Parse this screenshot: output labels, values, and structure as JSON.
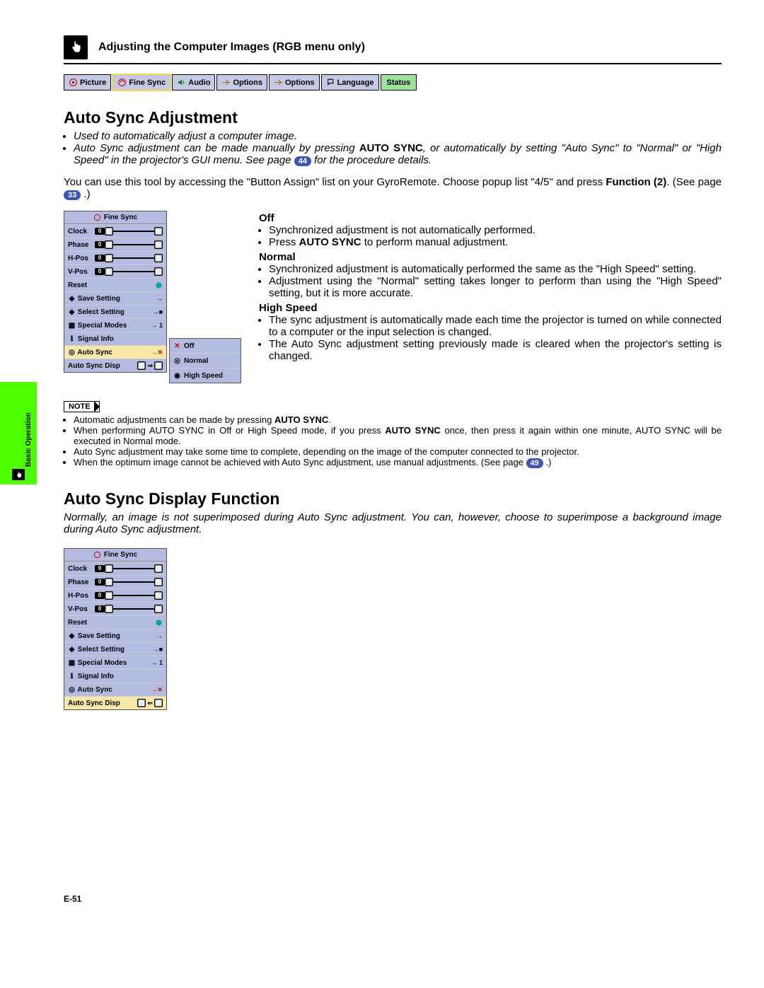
{
  "header": {
    "title": "Adjusting the Computer Images (RGB menu only)"
  },
  "tabs": {
    "picture": "Picture",
    "fine_sync": "Fine Sync",
    "audio": "Audio",
    "options1": "Options",
    "options2": "Options",
    "language": "Language",
    "status": "Status"
  },
  "section1": {
    "title": "Auto Sync Adjustment",
    "intro": {
      "b1": "Used to automatically adjust a computer image.",
      "b2a": "Auto Sync adjustment can be made manually by pressing ",
      "b2b": "AUTO SYNC",
      "b2c": ", or automatically by setting \"Auto Sync\" to \"Normal\" or \"High Speed\" in the projector's GUI menu. See page ",
      "b2_ref": "44",
      "b2d": " for the procedure details."
    },
    "body": {
      "t1": "You can use this tool by accessing the \"Button Assign\" list on your GyroRemote. Choose popup list \"4/5\" and press ",
      "t_bold": "Function (2)",
      "t2": ". (See page ",
      "ref": "33",
      "t3": " .)"
    }
  },
  "osd_menu": {
    "title": "Fine Sync",
    "rows": {
      "clock": "Clock",
      "phase": "Phase",
      "hpos": "H-Pos",
      "vpos": "V-Pos",
      "reset": "Reset"
    },
    "zero": "0",
    "subs": {
      "save": "Save Setting",
      "select": "Select Setting",
      "special": "Special Modes",
      "signal": "Signal Info",
      "auto_sync": "Auto Sync",
      "auto_sync_disp": "Auto Sync Disp"
    },
    "sub_marks": {
      "arrow": "→",
      "arrow_sq": "→■",
      "arrow_1": "→ 1",
      "arrow_x": "→✕"
    }
  },
  "popup": {
    "off": "Off",
    "normal": "Normal",
    "high_speed": "High Speed"
  },
  "modes": {
    "off": {
      "head": "Off",
      "b1": "Synchronized adjustment is not automatically performed.",
      "b2a": "Press ",
      "b2b": "AUTO SYNC",
      "b2c": " to perform manual adjustment."
    },
    "normal": {
      "head": "Normal",
      "b1": "Synchronized adjustment is automatically performed the same as the \"High Speed\" setting.",
      "b2": "Adjustment using the \"Normal\" setting takes longer to perform than using the \"High Speed\" setting, but it is more accurate."
    },
    "high_speed": {
      "head": "High Speed",
      "b1": "The sync adjustment is automatically made each time the projector is turned on while connected to a computer or the input selection is changed.",
      "b2": "The Auto Sync adjustment setting previously made is cleared when the projector's setting is changed."
    }
  },
  "note": {
    "label": "NOTE",
    "n1a": "Automatic adjustments can be made by pressing ",
    "n1b": "AUTO SYNC",
    "n1c": ".",
    "n2a": "When performing AUTO SYNC in Off or High Speed mode, if you press ",
    "n2b": "AUTO SYNC",
    "n2c": " once, then press it again within one minute, AUTO SYNC will be executed in Normal mode.",
    "n3": "Auto Sync adjustment may take some time to complete, depending on the image of the computer connected to the projector.",
    "n4a": "When the optimum image cannot be achieved with Auto Sync adjustment, use manual adjustments. (See page ",
    "n4_ref": "49",
    "n4b": " .)"
  },
  "section2": {
    "title": "Auto Sync Display Function",
    "intro": "Normally, an image is not superimposed during Auto Sync adjustment. You can, however, choose to superimpose a background image during Auto Sync adjustment."
  },
  "side": {
    "label": "Basic Operation"
  },
  "page_num": "E-51"
}
